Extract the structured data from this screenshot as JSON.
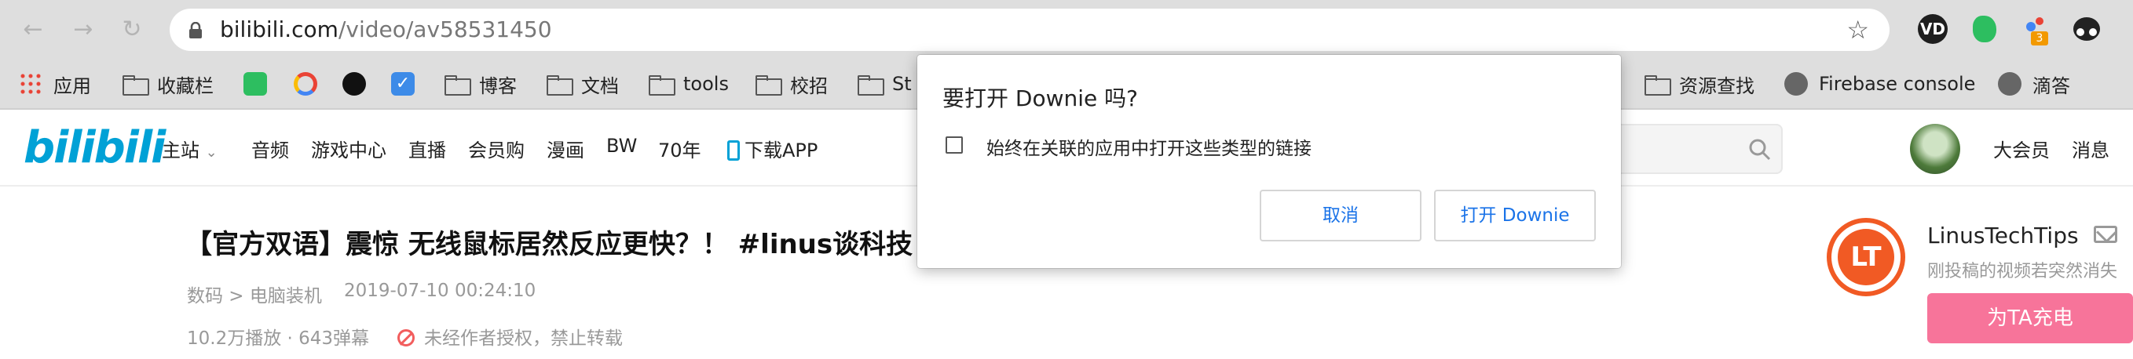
{
  "browser": {
    "url_host": "bilibili.com",
    "url_path": "/video/av58531450"
  },
  "bookmarks": [
    {
      "label": "应用",
      "icon": "apps-grid-icon"
    },
    {
      "label": "收藏栏",
      "icon": "folder-icon"
    },
    {
      "label": "",
      "icon": "evernote-icon"
    },
    {
      "label": "",
      "icon": "google-icon"
    },
    {
      "label": "",
      "icon": "github-icon"
    },
    {
      "label": "",
      "icon": "checkmark-icon"
    },
    {
      "label": "博客",
      "icon": "folder-icon"
    },
    {
      "label": "文档",
      "icon": "folder-icon"
    },
    {
      "label": "tools",
      "icon": "folder-icon"
    },
    {
      "label": "校招",
      "icon": "folder-icon"
    },
    {
      "label": "St",
      "icon": "folder-icon"
    },
    {
      "label": "资源查找",
      "icon": "folder-icon"
    },
    {
      "label": "Firebase console",
      "icon": "globe-icon"
    },
    {
      "label": "滴答",
      "icon": "globe-icon"
    }
  ],
  "site": {
    "logo": "bilibili",
    "nav": [
      "主站",
      "音频",
      "游戏中心",
      "直播",
      "会员购",
      "漫画",
      "BW",
      "70年",
      "下载APP"
    ],
    "header_links": [
      "大会员",
      "消息"
    ]
  },
  "video": {
    "title": "【官方双语】震惊 无线鼠标居然反应更快？！ #linus谈科技",
    "category": "数码 > 电脑装机",
    "date": "2019-07-10 00:24:10",
    "stats": "10.2万播放 · 643弹幕",
    "copyright": "未经作者授权，禁止转载"
  },
  "uploader": {
    "name": "LinusTechTips",
    "message_label": "发",
    "description": "刚投稿的视频若突然消失",
    "charge_label": "为TA充电",
    "charge_color": "#f7749a"
  },
  "dialog": {
    "title": "要打开 Downie 吗?",
    "checkbox_label": "始终在关联的应用中打开这些类型的链接",
    "checkbox_checked": false,
    "cancel_label": "取消",
    "open_label": "打开 Downie",
    "button_text_color": "#1a73e8"
  },
  "extensions": [
    {
      "icon": "vd-extension-icon"
    },
    {
      "icon": "evernote-icon"
    },
    {
      "icon": "extension-dots-icon",
      "badge": "3"
    },
    {
      "icon": "incognito-icon"
    }
  ]
}
